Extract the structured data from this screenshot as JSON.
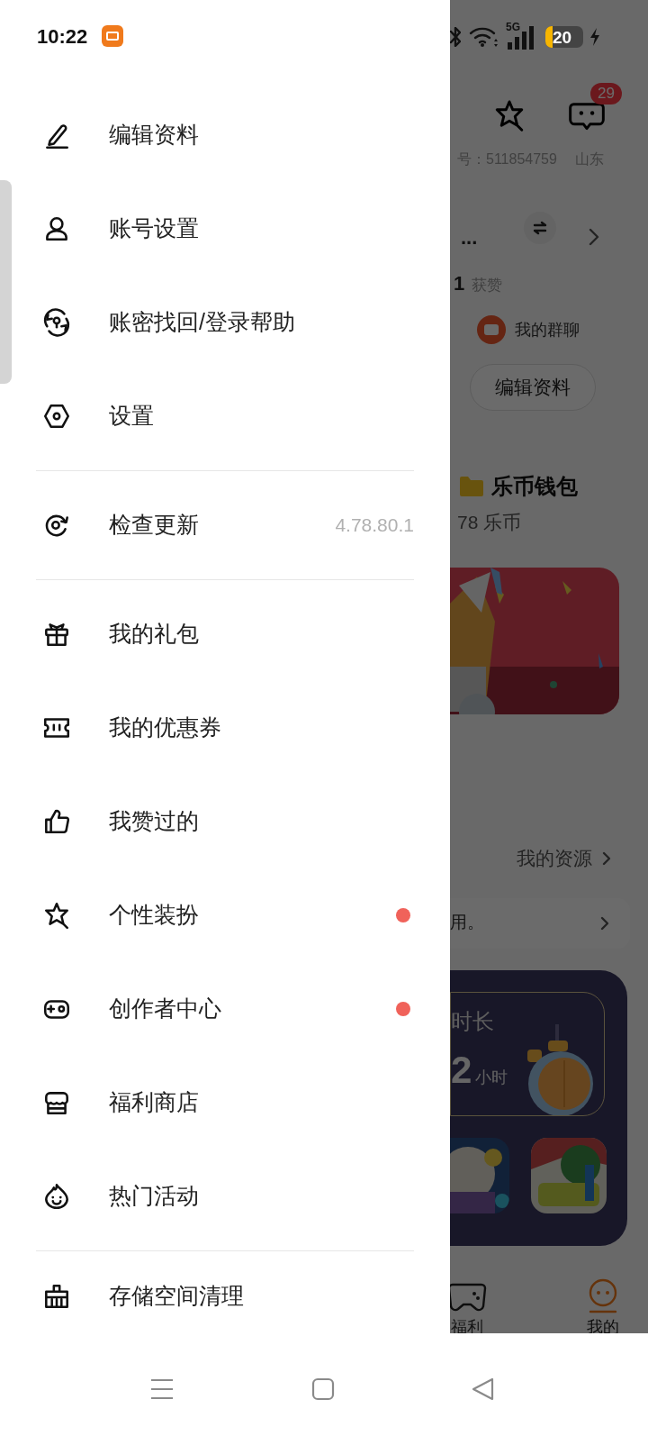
{
  "status_bar": {
    "time": "10:22",
    "network": "5G",
    "battery": "20",
    "charging": true
  },
  "drawer": {
    "groups": [
      {
        "items": [
          {
            "label": "编辑资料",
            "new": false
          },
          {
            "label": "账号设置",
            "new": false
          },
          {
            "label": "账密找回/登录帮助",
            "new": false
          },
          {
            "label": "设置",
            "new": false
          }
        ]
      },
      {
        "items": [
          {
            "label": "检查更新",
            "value": "4.78.80.1",
            "new": false
          }
        ]
      },
      {
        "items": [
          {
            "label": "我的礼包",
            "new": false
          },
          {
            "label": "我的优惠券",
            "new": false
          },
          {
            "label": "我赞过的",
            "new": false
          },
          {
            "label": "个性装扮",
            "new": true
          },
          {
            "label": "创作者中心",
            "new": true
          },
          {
            "label": "福利商店",
            "new": false
          },
          {
            "label": "热门活动",
            "new": false
          }
        ]
      },
      {
        "items": [
          {
            "label": "存储空间清理",
            "new": false
          }
        ]
      }
    ]
  },
  "background_page": {
    "message_badge": "29",
    "user_id": "号：511854759",
    "region": "山东",
    "name": "...",
    "likes_count": "1",
    "likes_label": "获赞",
    "group_chat": "我的群聊",
    "edit_button": "编辑资料",
    "wallet_title": "乐币钱包",
    "wallet_balance": "78 乐币",
    "resources_link": "我的资源",
    "notice": "用。",
    "playtime_label": "时长",
    "playtime_value": "2",
    "playtime_unit": "小时",
    "nav": [
      {
        "label": "福利",
        "selected": false
      },
      {
        "label": "我的",
        "selected": true
      }
    ]
  }
}
